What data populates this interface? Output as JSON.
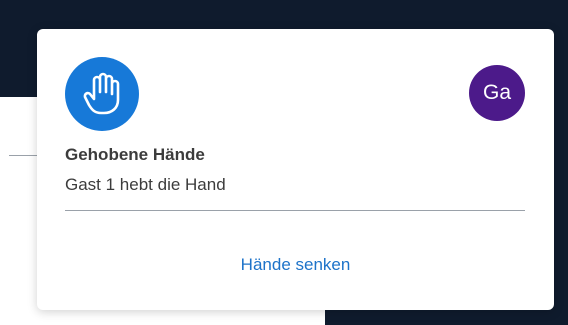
{
  "popup": {
    "icon": "raised-hand-icon",
    "avatar_initials": "Ga",
    "title": "Gehobene Hände",
    "message": "Gast 1 hebt die Hand",
    "lower_hands_label": "Hände senken"
  },
  "colors": {
    "accent": "#1779d8",
    "avatar": "#4c1a8a",
    "link": "#1d73c9",
    "background_dark": "#0f1b2d"
  }
}
